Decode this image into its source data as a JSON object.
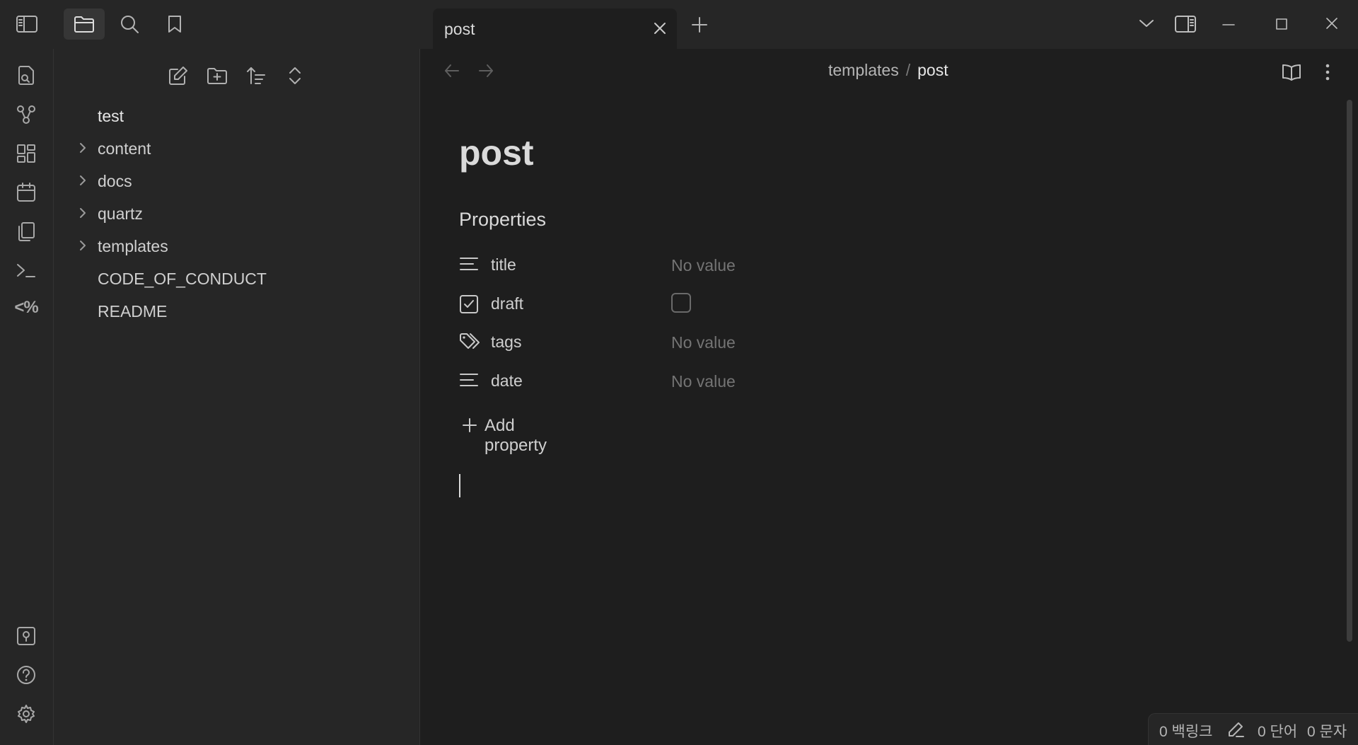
{
  "window": {
    "tab_title": "post"
  },
  "icons": {
    "titlebar": [
      "sidebar-toggle-icon",
      "folder-icon",
      "search-icon",
      "bookmark-icon"
    ],
    "window_controls": [
      "chevron-down-icon",
      "split-view-icon",
      "minimize-icon",
      "maximize-icon",
      "close-icon"
    ],
    "ribbon": [
      "file-search-icon",
      "graph-icon",
      "canvas-icon",
      "calendar-icon",
      "copy-icon",
      "terminal-icon",
      "templater-icon",
      "vault-icon",
      "help-icon",
      "gear-icon"
    ],
    "sidebar_actions": [
      "new-note-icon",
      "new-folder-icon",
      "sort-icon",
      "collapse-icon"
    ]
  },
  "ribbon": {
    "templater_text": "<%"
  },
  "sidebar": {
    "root": "test",
    "items": [
      {
        "label": "content",
        "folder": true
      },
      {
        "label": "docs",
        "folder": true
      },
      {
        "label": "quartz",
        "folder": true
      },
      {
        "label": "templates",
        "folder": true
      },
      {
        "label": "CODE_OF_CONDUCT",
        "folder": false
      },
      {
        "label": "README",
        "folder": false
      }
    ]
  },
  "main": {
    "breadcrumb": {
      "parent": "templates",
      "separator": "/",
      "current": "post"
    },
    "title": "post",
    "properties_heading": "Properties",
    "properties": [
      {
        "name": "title",
        "icon": "text-lines-icon",
        "value": "No value"
      },
      {
        "name": "draft",
        "icon": "checkbox-icon",
        "checked": false
      },
      {
        "name": "tags",
        "icon": "tags-icon",
        "value": "No value"
      },
      {
        "name": "date",
        "icon": "text-lines-icon",
        "value": "No value"
      }
    ],
    "add_property": "Add property"
  },
  "status": {
    "backlinks": "0 백링크",
    "words": "0 단어",
    "chars": "0 문자"
  },
  "colors": {
    "background": "#1e1e1e",
    "panel": "#262626",
    "text": "#dadada",
    "muted": "#747474"
  }
}
